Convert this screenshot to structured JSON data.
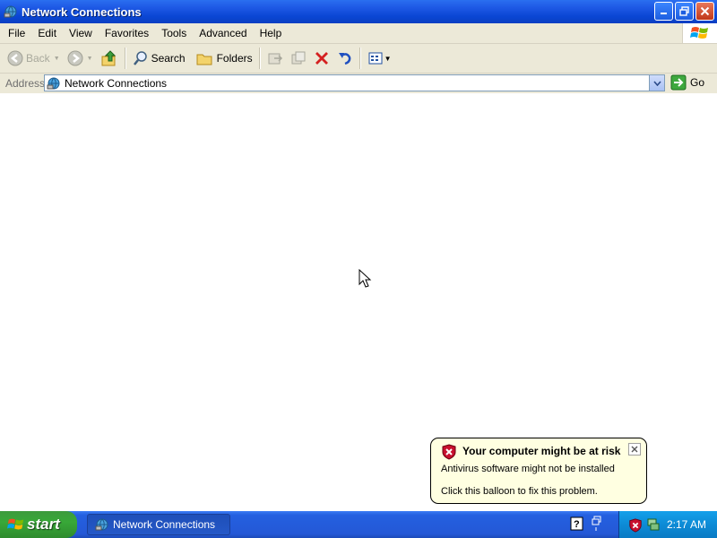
{
  "window": {
    "title": "Network Connections"
  },
  "menu": [
    "File",
    "Edit",
    "View",
    "Favorites",
    "Tools",
    "Advanced",
    "Help"
  ],
  "toolbar": {
    "back_label": "Back",
    "search_label": "Search",
    "folders_label": "Folders"
  },
  "address": {
    "label": "Address",
    "value": "Network Connections",
    "go_label": "Go"
  },
  "balloon": {
    "title": "Your computer might be at risk",
    "line1": "Antivirus software might not be installed",
    "line2": "Click this balloon to fix this problem."
  },
  "taskbar": {
    "start_label": "start",
    "task_label": "Network Connections",
    "clock": "2:17 AM"
  },
  "colors": {
    "titlebar": "#0a46d4",
    "taskbar": "#2458d6",
    "start": "#38a838",
    "balloon_bg": "#ffffe1",
    "tray": "#0d8bd6"
  }
}
